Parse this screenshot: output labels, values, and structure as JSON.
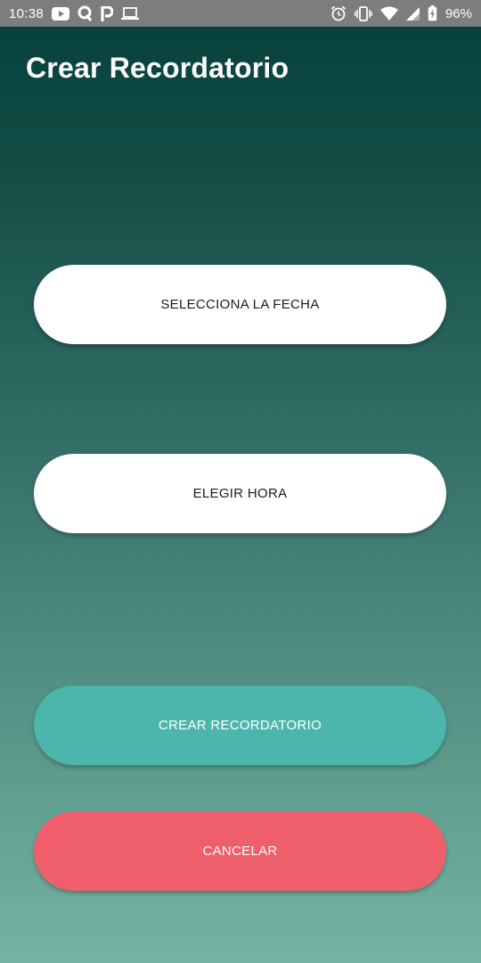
{
  "status_bar": {
    "time": "10:38",
    "battery_percent": "96%",
    "left_icons": [
      "youtube-icon",
      "q-app-icon",
      "p-app-icon",
      "laptop-icon"
    ],
    "right_icons": [
      "alarm-icon",
      "vibrate-icon",
      "wifi-icon",
      "signal-icon",
      "battery-charging-icon"
    ]
  },
  "header": {
    "title": "Crear Recordatorio"
  },
  "buttons": {
    "select_date": "SELECCIONA LA FECHA",
    "choose_time": "ELEGIR HORA",
    "create_reminder": "CREAR RECORDATORIO",
    "cancel": "CANCELAR"
  },
  "colors": {
    "background_top": "#06403b",
    "background_bottom": "#75b4a2",
    "status_bar": "#7d7d7d",
    "primary_button": "#4db6ac",
    "cancel_button": "#ef5f6b",
    "secondary_button": "#ffffff"
  }
}
